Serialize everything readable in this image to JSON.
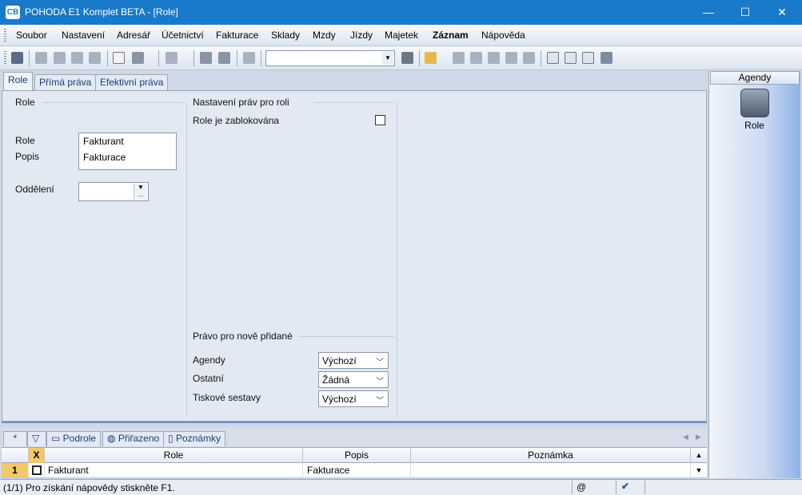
{
  "window": {
    "title": "POHODA E1 Komplet BETA - [Role]",
    "app_icon": "pohoda-app-icon",
    "controls": {
      "minimize": "—",
      "maximize": "☐",
      "close": "✕"
    }
  },
  "menu": {
    "items": [
      "Soubor",
      "Nastavení",
      "Adresář",
      "Účetnictví",
      "Fakturace",
      "Sklady",
      "Mzdy",
      "Jízdy",
      "Majetek",
      "Záznam",
      "Nápověda"
    ]
  },
  "toolbar": {
    "search_value": ""
  },
  "tabs": [
    "Role",
    "Přímá práva",
    "Efektivní práva"
  ],
  "form": {
    "section_role": "Role",
    "role_label": "Role",
    "role_value": "Fakturant",
    "popis_label": "Popis",
    "popis_value": "Fakturace",
    "oddeleni_label": "Oddělení",
    "oddeleni_value": "",
    "section_rights": "Nastavení práv pro roli",
    "blocked_label": "Role je zablokována",
    "section_new_rights": "Právo pro nově přidané",
    "agendy_label": "Agendy",
    "agendy_value": "Výchozí",
    "ostatni_label": "Ostatní",
    "ostatni_value": "Žádná",
    "tiskove_label": "Tiskové sestavy",
    "tiskove_value": "Výchozí"
  },
  "bottom_tabs": [
    "*",
    "Podrole",
    "Přiřazeno",
    "Poznámky"
  ],
  "grid": {
    "columns": [
      "X",
      "Role",
      "Popis",
      "Poznámka"
    ],
    "rows": [
      {
        "num": "1",
        "role": "Fakturant",
        "popis": "Fakturace",
        "poznamka": ""
      }
    ]
  },
  "agenda_panel": {
    "header": "Agendy",
    "item_label": "Role"
  },
  "status": {
    "text": "(1/1) Pro získání nápovědy stiskněte F1.",
    "at_symbol": "@"
  }
}
